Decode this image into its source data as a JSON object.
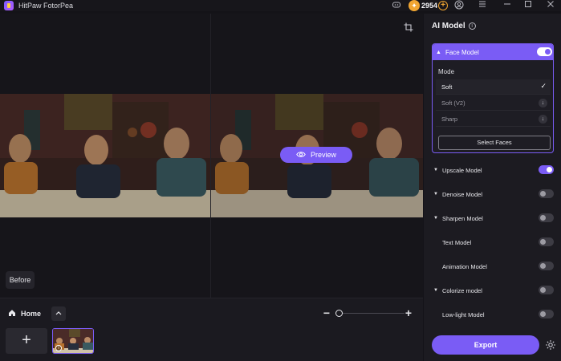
{
  "app": {
    "title": "HitPaw FotorPea"
  },
  "titlebar": {
    "coins": "2954"
  },
  "canvas": {
    "preview_label": "Preview",
    "before_label": "Before"
  },
  "bottom": {
    "home_label": "Home"
  },
  "panel": {
    "title": "AI Model",
    "face_model": {
      "label": "Face Model",
      "enabled": true,
      "mode_label": "Mode",
      "modes": [
        {
          "label": "Soft",
          "selected": true
        },
        {
          "label": "Soft (V2)",
          "selected": false
        },
        {
          "label": "Sharp",
          "selected": false
        }
      ],
      "select_faces_label": "Select Faces"
    },
    "models": [
      {
        "label": "Upscale Model",
        "enabled": true,
        "expandable": true
      },
      {
        "label": "Denoise Model",
        "enabled": false,
        "expandable": true
      },
      {
        "label": "Sharpen Model",
        "enabled": false,
        "expandable": true
      },
      {
        "label": "Text Model",
        "enabled": false,
        "expandable": false
      },
      {
        "label": "Animation Model",
        "enabled": false,
        "expandable": false
      },
      {
        "label": "Colorize model",
        "enabled": false,
        "expandable": true
      },
      {
        "label": "Low-light Model",
        "enabled": false,
        "expandable": false
      }
    ],
    "export_label": "Export"
  },
  "colors": {
    "accent": "#7a5cf5",
    "coin": "#f0a531",
    "background": "#141318",
    "panel": "#1c1b21"
  }
}
